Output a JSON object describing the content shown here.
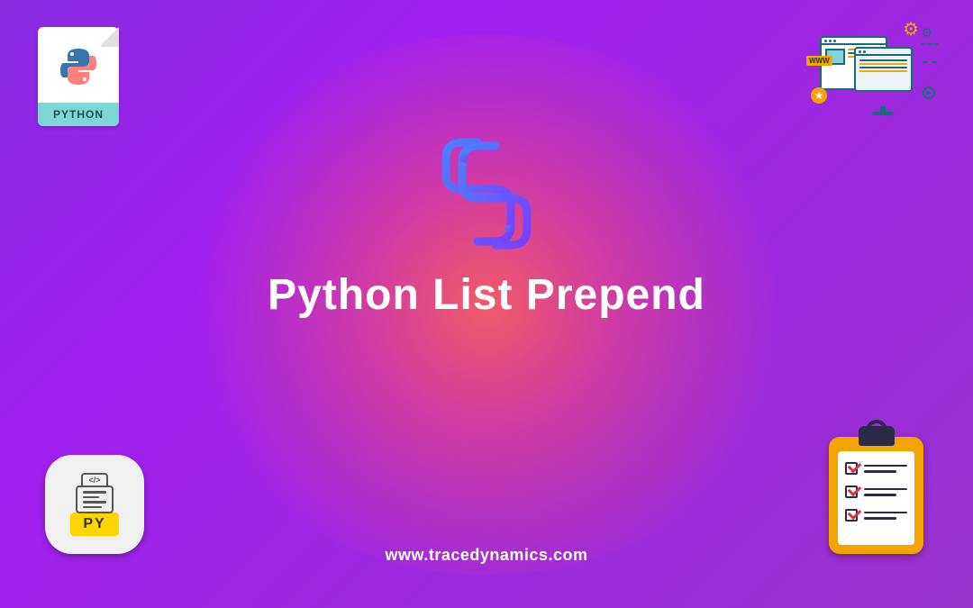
{
  "main": {
    "title": "Python List Prepend",
    "website": "www.tracedynamics.com"
  },
  "icons": {
    "top_left_label": "PYTHON",
    "bottom_left_label": "PY",
    "bottom_left_code_symbol": "</>",
    "www_label": "WWW"
  }
}
